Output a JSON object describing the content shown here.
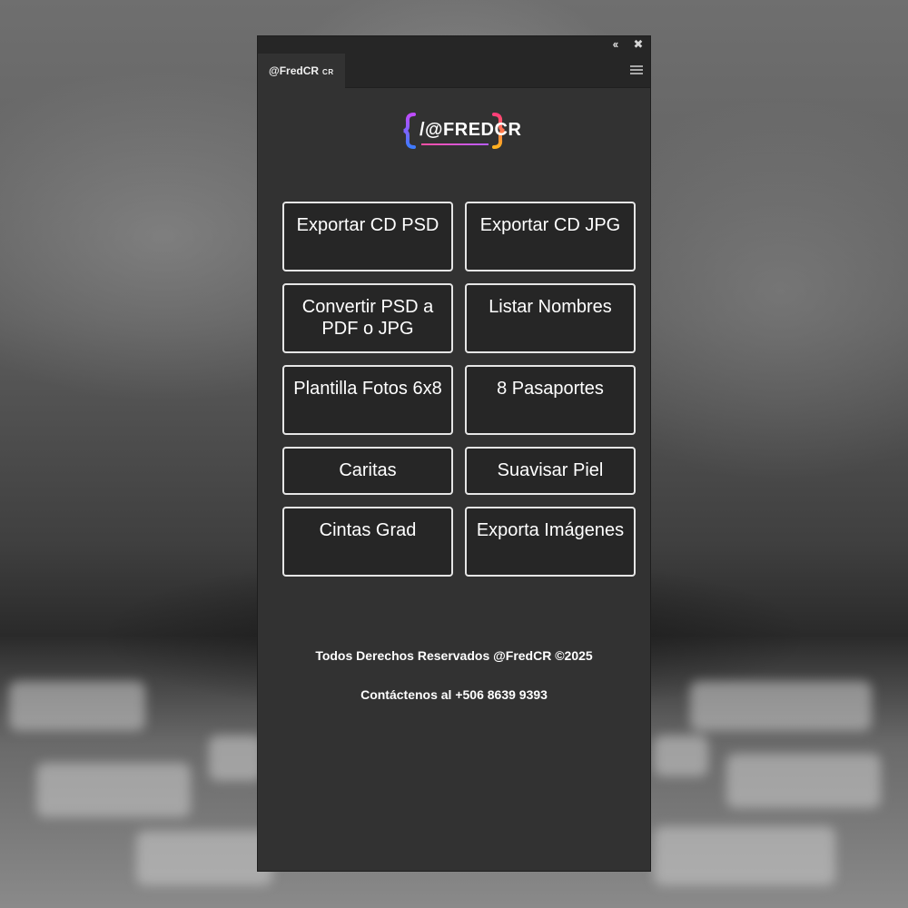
{
  "panel": {
    "controls": {
      "collapse_glyph": "‹‹",
      "close_glyph": "✖"
    },
    "tab": {
      "title": "@FredCR",
      "suffix": "CR"
    },
    "menu_icon": "hamburger-menu-icon"
  },
  "logo": {
    "text": "/@FREDCR",
    "bracket_left": "{",
    "bracket_right": "}",
    "colors": {
      "left_bracket": "#8b5cf6",
      "right_bracket": "#f59e0b",
      "underline": "#ff4fa3"
    }
  },
  "buttons": [
    {
      "label": "Exportar CD PSD"
    },
    {
      "label": "Exportar CD JPG"
    },
    {
      "label": "Convertir PSD a PDF o JPG"
    },
    {
      "label": "Listar Nombres"
    },
    {
      "label": "Plantilla Fotos 6x8"
    },
    {
      "label": "8 Pasaportes"
    },
    {
      "label": "Caritas"
    },
    {
      "label": "Suavisar Piel"
    },
    {
      "label": "Cintas Grad"
    },
    {
      "label": "Exporta Imágenes"
    }
  ],
  "footer": {
    "rights": "Todos Derechos Reservados @FredCR ©2025",
    "contact": "Contáctenos al +506 8639 9393"
  },
  "colors": {
    "panel_bg": "#323232",
    "button_bg": "#262626",
    "button_border": "#e6e6e6",
    "text": "#ffffff"
  }
}
